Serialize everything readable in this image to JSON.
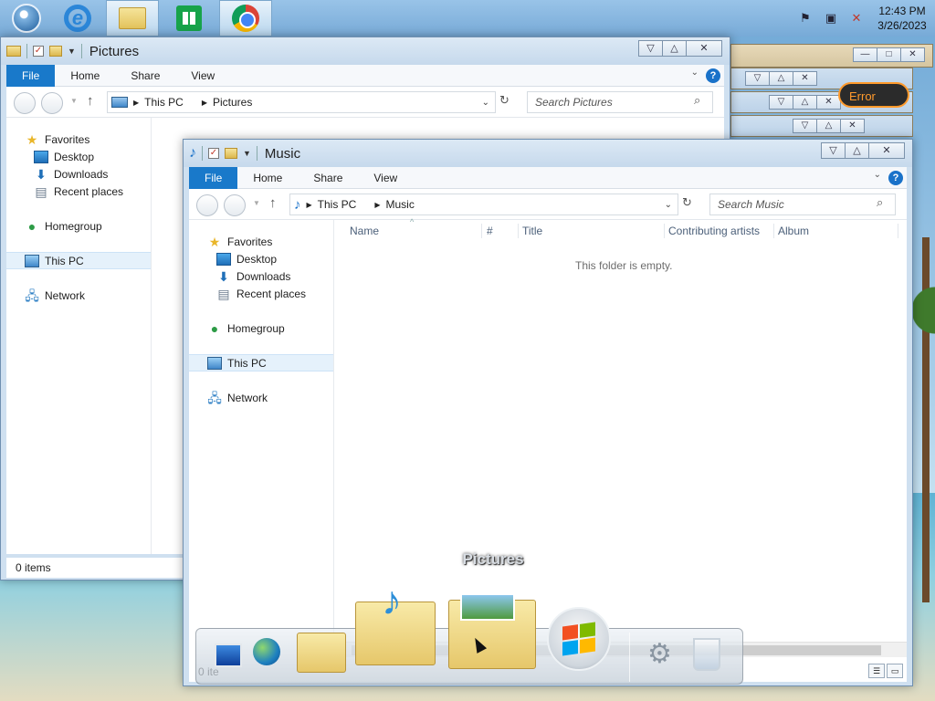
{
  "taskbar": {
    "buttons": [
      "start",
      "internet-explorer",
      "file-explorer",
      "store",
      "chrome"
    ],
    "clock": {
      "time": "12:43 PM",
      "date": "3/26/2023"
    }
  },
  "pictures_window": {
    "title": "Pictures",
    "tabs": [
      "File",
      "Home",
      "Share",
      "View"
    ],
    "address": [
      "This PC",
      "Pictures"
    ],
    "search_placeholder": "Search Pictures",
    "nav": {
      "favorites": "Favorites",
      "desktop": "Desktop",
      "downloads": "Downloads",
      "recent": "Recent places",
      "homegroup": "Homegroup",
      "thispc": "This PC",
      "network": "Network"
    },
    "status": "0 items"
  },
  "music_window": {
    "title": "Music",
    "tabs": [
      "File",
      "Home",
      "Share",
      "View"
    ],
    "address": [
      "This PC",
      "Music"
    ],
    "search_placeholder": "Search Music",
    "nav": {
      "favorites": "Favorites",
      "desktop": "Desktop",
      "downloads": "Downloads",
      "recent": "Recent places",
      "homegroup": "Homegroup",
      "thispc": "This PC",
      "network": "Network"
    },
    "columns": [
      "Name",
      "#",
      "Title",
      "Contributing artists",
      "Album"
    ],
    "empty_message": "This folder is empty.",
    "status": "0 ite"
  },
  "background": {
    "error_label": "Error"
  },
  "dock": {
    "hover_label": "Pictures",
    "items": [
      "computer",
      "network",
      "documents",
      "music",
      "pictures",
      "start",
      "settings",
      "recycle-bin"
    ]
  },
  "colors": {
    "accent": "#1979ca",
    "error": "#ff9a2c"
  }
}
